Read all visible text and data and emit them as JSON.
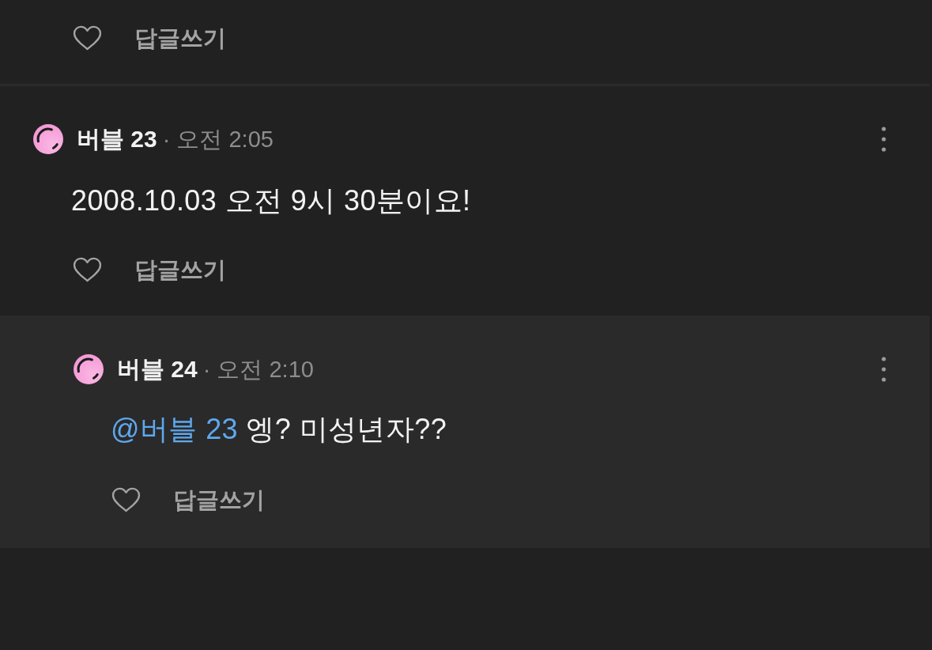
{
  "comments": [
    {
      "liked": false,
      "reply_label": "답글쓰기"
    },
    {
      "author": "버블 23",
      "timestamp": "· 오전 2:05",
      "text": "2008.10.03 오전 9시 30분이요!",
      "liked": false,
      "reply_label": "답글쓰기",
      "replies": [
        {
          "author": "버블 24",
          "timestamp": "· 오전 2:10",
          "mention": "@버블 23",
          "text": "엥? 미성년자??",
          "liked": false,
          "reply_label": "답글쓰기"
        }
      ]
    }
  ]
}
